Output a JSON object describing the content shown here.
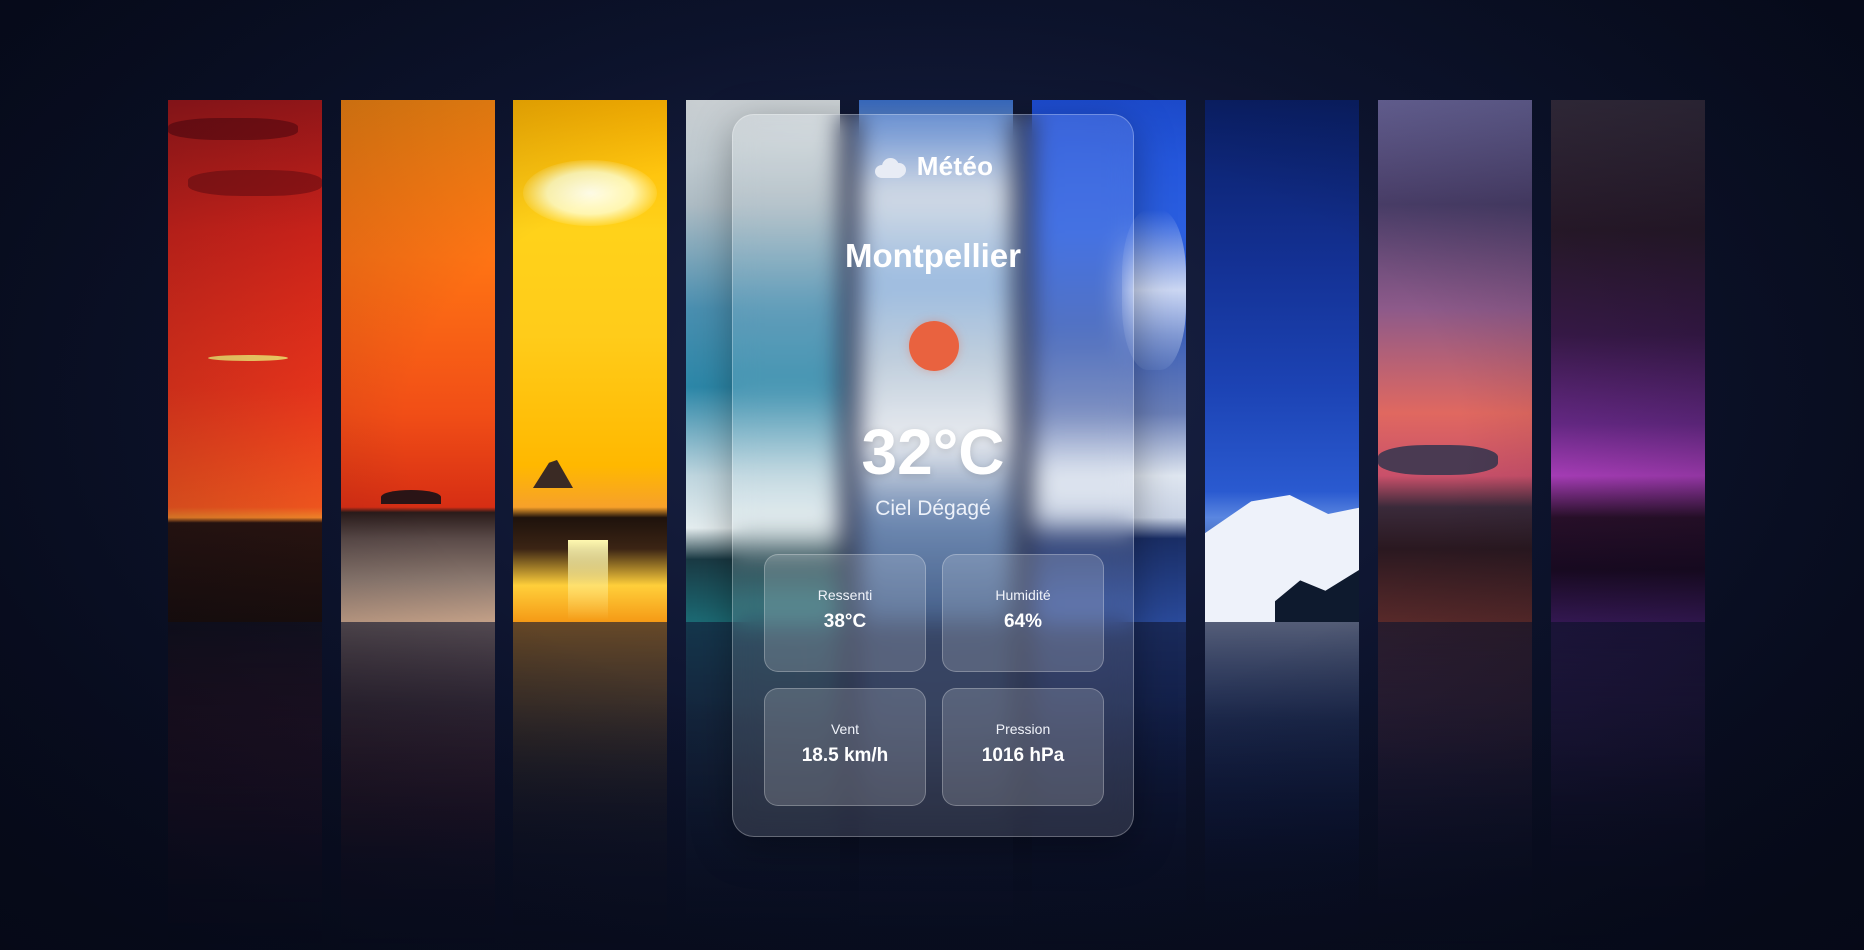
{
  "app": {
    "title": "Météo",
    "icon": "cloud-icon"
  },
  "weather": {
    "city": "Montpellier",
    "icon": "sun-icon",
    "icon_color": "#e9623f",
    "temperature": "32°C",
    "condition": "Ciel Dégagé"
  },
  "stats": [
    {
      "label": "Ressenti",
      "value": "38°C"
    },
    {
      "label": "Humidité",
      "value": "64%"
    },
    {
      "label": "Vent",
      "value": "18.5 km/h"
    },
    {
      "label": "Pression",
      "value": "1016 hPa"
    }
  ],
  "background": {
    "description_strips": [
      "red-sunset",
      "orange-sunset",
      "yellow-sun",
      "cloudy-teal",
      "cloudy-blue",
      "blue-sky",
      "navy-mountain",
      "purple-dusk",
      "violet-night"
    ]
  }
}
